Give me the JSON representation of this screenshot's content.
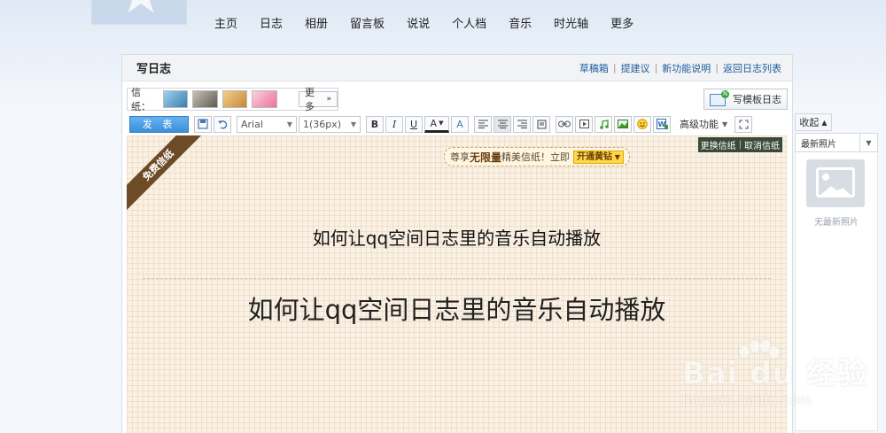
{
  "nav": {
    "items": [
      "主页",
      "日志",
      "相册",
      "留言板",
      "说说",
      "个人档",
      "音乐",
      "时光轴",
      "更多"
    ]
  },
  "panel": {
    "title": "写日志",
    "links": [
      "草稿箱",
      "提建议",
      "新功能说明",
      "返回日志列表"
    ]
  },
  "papers": {
    "label": "信纸：",
    "more_label": "更多",
    "template_label": "写模板日志"
  },
  "toolbar": {
    "publish_label": "发 表",
    "font_value": "Arial",
    "size_value": "1(36px)",
    "advanced_label": "高级功能"
  },
  "editor": {
    "ribbon": "免费信纸",
    "promo_prefix": "尊享",
    "promo_bold": "无限量",
    "promo_suffix": "精美信纸！立即",
    "promo_button": "开通黄钻",
    "switch_paper": "更换信纸",
    "cancel_paper": "取消信纸",
    "title_small": "如何让qq空间日志里的音乐自动播放",
    "title_large": "如何让qq空间日志里的音乐自动播放"
  },
  "sidebar": {
    "collapse_label": "收起",
    "select_value": "最新照片",
    "empty_text": "无最新照片"
  },
  "watermark": {
    "brand": "Bai du 经验",
    "url": "jingyan.baidu.com"
  },
  "colors": {
    "accent": "#3b8fd8",
    "link": "#1d5c9c",
    "paper_bg": "#faf1e4",
    "ribbon": "#6d4b26"
  }
}
